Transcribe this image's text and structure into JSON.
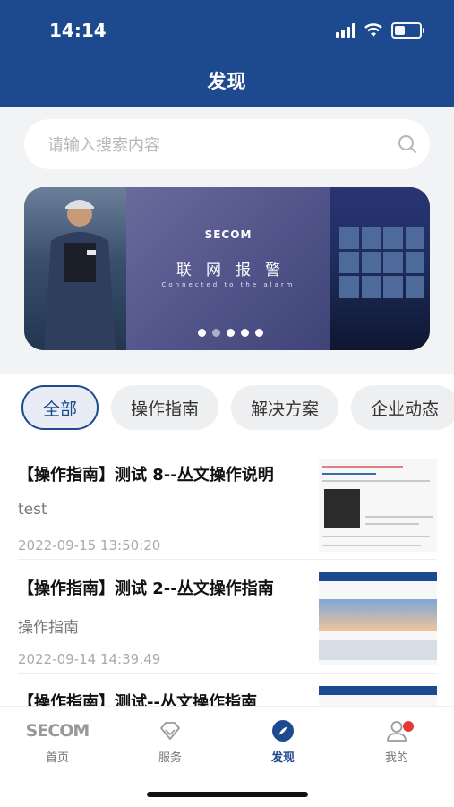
{
  "status_bar": {
    "time": "14:14"
  },
  "header": {
    "title": "发现"
  },
  "search": {
    "placeholder": "请输入搜索内容"
  },
  "banner": {
    "logo_text": "SECOM",
    "title": "联网报警",
    "subtitle": "Connected to the alarm",
    "dot_count": 5,
    "active_dot": 1
  },
  "tabs": [
    {
      "label": "全部",
      "active": true
    },
    {
      "label": "操作指南",
      "active": false
    },
    {
      "label": "解决方案",
      "active": false
    },
    {
      "label": "企业动态",
      "active": false
    }
  ],
  "articles": [
    {
      "title": "【操作指南】测试 8--丛文操作说明",
      "desc": "test",
      "date": "2022-09-15 13:50:20"
    },
    {
      "title": "【操作指南】测试 2--丛文操作指南",
      "desc": "操作指南",
      "date": "2022-09-14 14:39:49"
    },
    {
      "title": "【操作指南】测试--丛文操作指南",
      "desc": "",
      "date": ""
    }
  ],
  "bottom_nav": [
    {
      "label": "首页",
      "icon": "secom-logo-icon",
      "active": false
    },
    {
      "label": "服务",
      "icon": "diamond-icon",
      "active": false
    },
    {
      "label": "发现",
      "icon": "compass-icon",
      "active": true
    },
    {
      "label": "我的",
      "icon": "user-icon",
      "active": false,
      "badge": true
    }
  ],
  "colors": {
    "brand": "#1d4a8f",
    "badge": "#e53935"
  }
}
